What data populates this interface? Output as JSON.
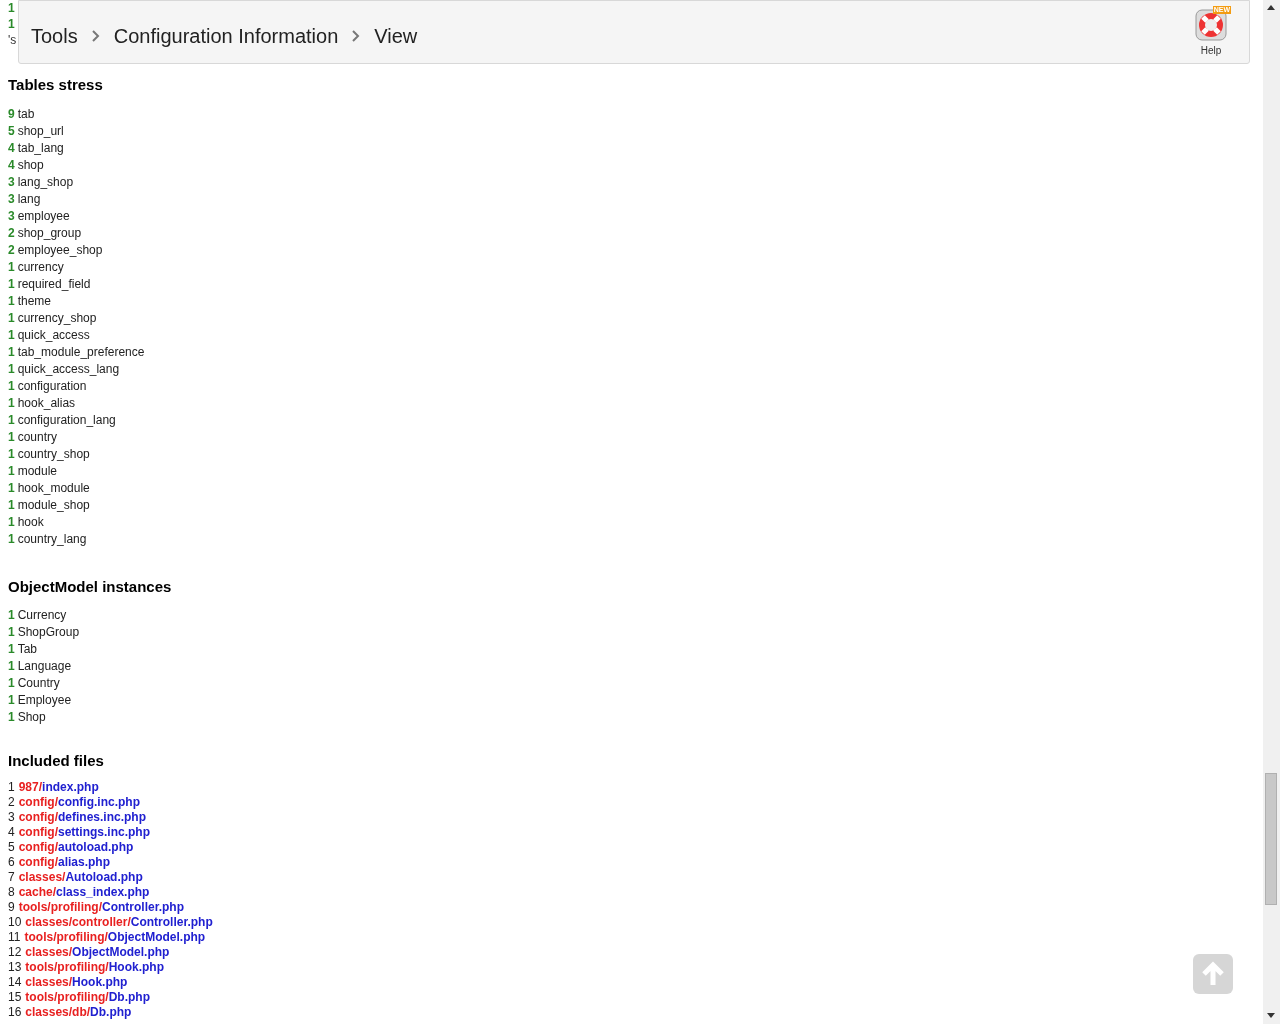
{
  "queries": [
    {
      "count": "1"
    },
    {
      "count": "1",
      "continuation": "'s"
    }
  ],
  "breadcrumb": [
    "Tools",
    "Configuration Information",
    "View"
  ],
  "help": {
    "label": "Help",
    "badge": "NEW"
  },
  "tables_stress": {
    "title": "Tables stress",
    "items": [
      {
        "count": "9",
        "name": "tab"
      },
      {
        "count": "5",
        "name": "shop_url"
      },
      {
        "count": "4",
        "name": "tab_lang"
      },
      {
        "count": "4",
        "name": "shop"
      },
      {
        "count": "3",
        "name": "lang_shop"
      },
      {
        "count": "3",
        "name": "lang"
      },
      {
        "count": "3",
        "name": "employee"
      },
      {
        "count": "2",
        "name": "shop_group"
      },
      {
        "count": "2",
        "name": "employee_shop"
      },
      {
        "count": "1",
        "name": "currency"
      },
      {
        "count": "1",
        "name": "required_field"
      },
      {
        "count": "1",
        "name": "theme"
      },
      {
        "count": "1",
        "name": "currency_shop"
      },
      {
        "count": "1",
        "name": "quick_access"
      },
      {
        "count": "1",
        "name": "tab_module_preference"
      },
      {
        "count": "1",
        "name": "quick_access_lang"
      },
      {
        "count": "1",
        "name": "configuration"
      },
      {
        "count": "1",
        "name": "hook_alias"
      },
      {
        "count": "1",
        "name": "configuration_lang"
      },
      {
        "count": "1",
        "name": "country"
      },
      {
        "count": "1",
        "name": "country_shop"
      },
      {
        "count": "1",
        "name": "module"
      },
      {
        "count": "1",
        "name": "hook_module"
      },
      {
        "count": "1",
        "name": "module_shop"
      },
      {
        "count": "1",
        "name": "hook"
      },
      {
        "count": "1",
        "name": "country_lang"
      }
    ]
  },
  "object_model": {
    "title": "ObjectModel instances",
    "items": [
      {
        "count": "1",
        "name": "Currency"
      },
      {
        "count": "1",
        "name": "ShopGroup"
      },
      {
        "count": "1",
        "name": "Tab"
      },
      {
        "count": "1",
        "name": "Language"
      },
      {
        "count": "1",
        "name": "Country"
      },
      {
        "count": "1",
        "name": "Employee"
      },
      {
        "count": "1",
        "name": "Shop"
      }
    ]
  },
  "included_files": {
    "title": "Included files",
    "items": [
      {
        "number": "1",
        "dir": "987/",
        "file": "index.php"
      },
      {
        "number": "2",
        "dir": "config/",
        "file": "config.inc.php"
      },
      {
        "number": "3",
        "dir": "config/",
        "file": "defines.inc.php"
      },
      {
        "number": "4",
        "dir": "config/",
        "file": "settings.inc.php"
      },
      {
        "number": "5",
        "dir": "config/",
        "file": "autoload.php"
      },
      {
        "number": "6",
        "dir": "config/",
        "file": "alias.php"
      },
      {
        "number": "7",
        "dir": "classes/",
        "file": "Autoload.php"
      },
      {
        "number": "8",
        "dir": "cache/",
        "file": "class_index.php"
      },
      {
        "number": "9",
        "dir": "tools/profiling/",
        "file": "Controller.php"
      },
      {
        "number": "10",
        "dir": "classes/controller/",
        "file": "Controller.php"
      },
      {
        "number": "11",
        "dir": "tools/profiling/",
        "file": "ObjectModel.php"
      },
      {
        "number": "12",
        "dir": "classes/",
        "file": "ObjectModel.php"
      },
      {
        "number": "13",
        "dir": "tools/profiling/",
        "file": "Hook.php"
      },
      {
        "number": "14",
        "dir": "classes/",
        "file": "Hook.php"
      },
      {
        "number": "15",
        "dir": "tools/profiling/",
        "file": "Db.php"
      },
      {
        "number": "16",
        "dir": "classes/db/",
        "file": "Db.php"
      }
    ]
  }
}
